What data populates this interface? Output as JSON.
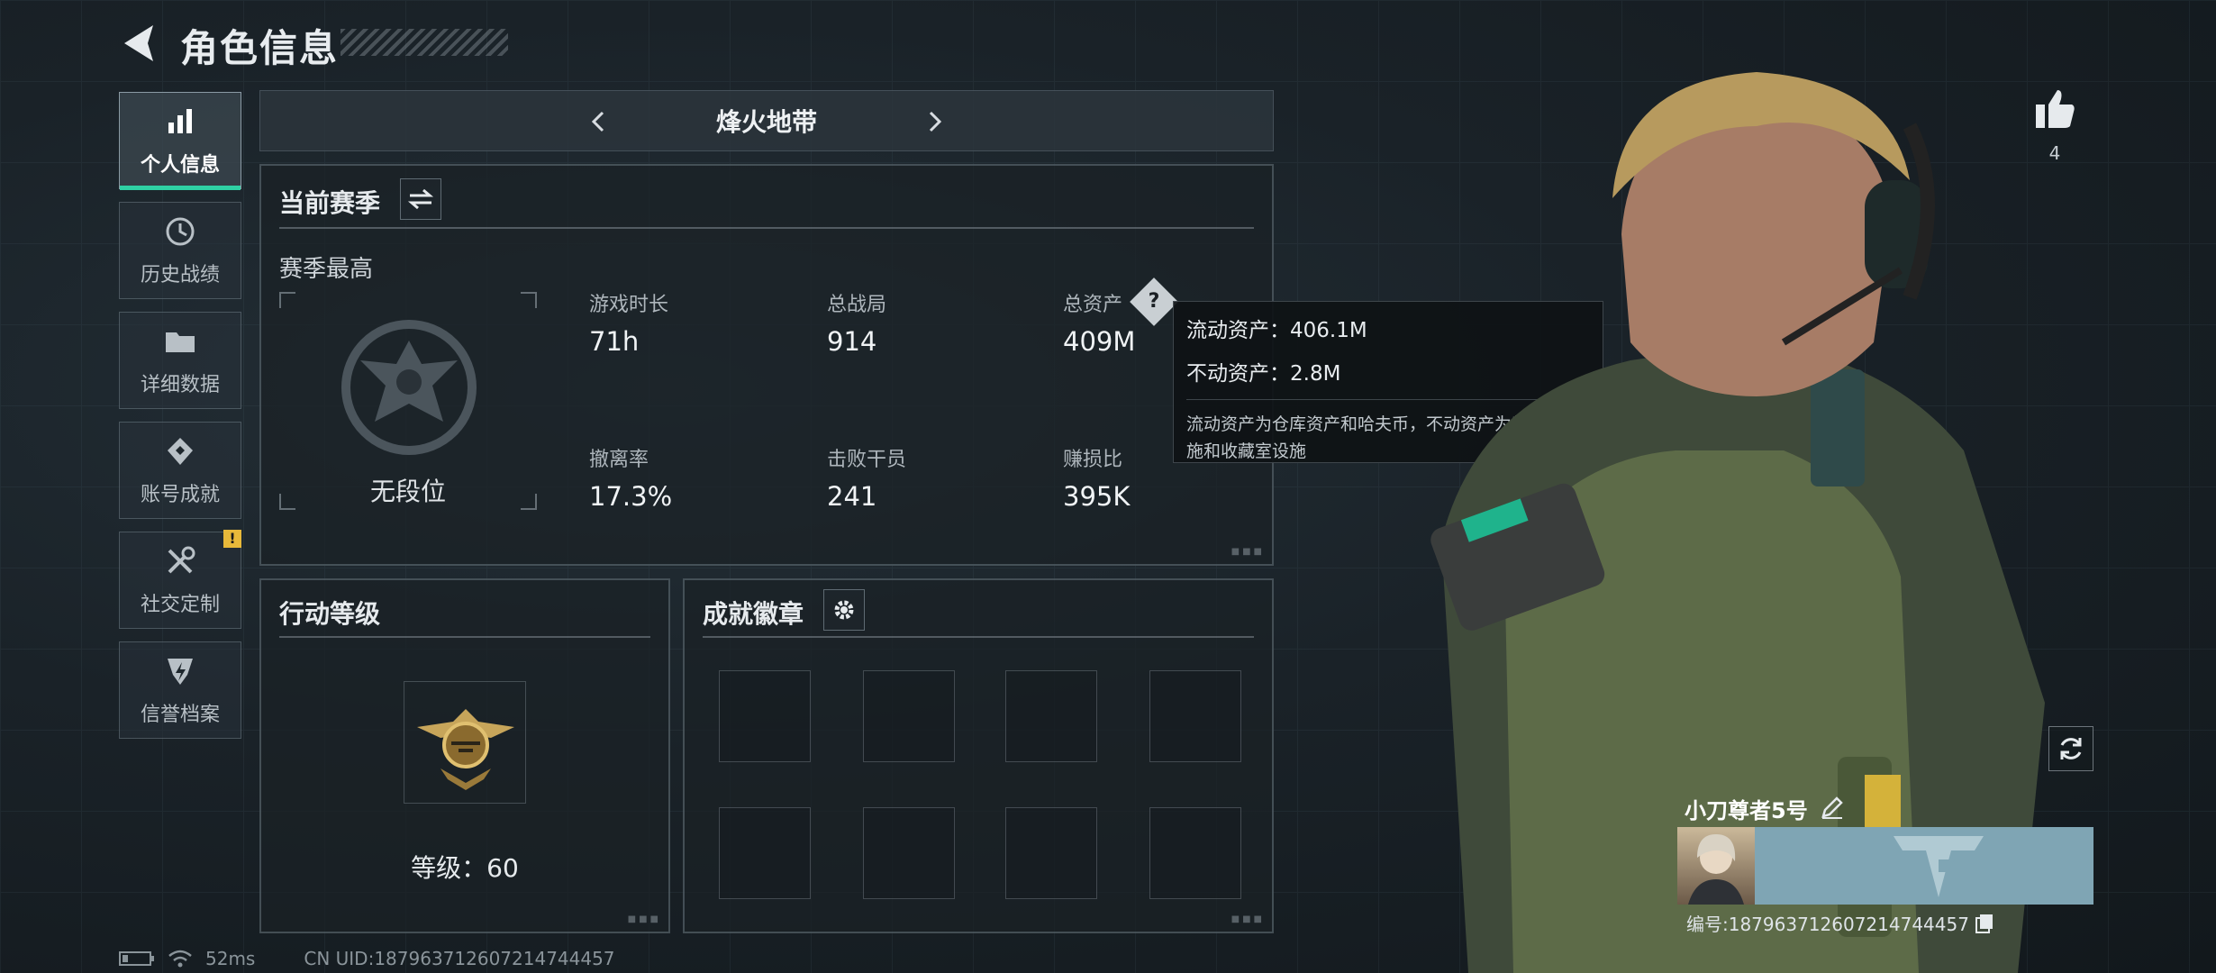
{
  "header": {
    "title": "角色信息"
  },
  "sidebar": {
    "items": [
      {
        "label": "个人信息",
        "icon": "bar-chart-icon"
      },
      {
        "label": "历史战绩",
        "icon": "history-icon"
      },
      {
        "label": "详细数据",
        "icon": "folder-icon"
      },
      {
        "label": "账号成就",
        "icon": "achievement-icon"
      },
      {
        "label": "社交定制",
        "icon": "tools-icon",
        "badge": "!"
      },
      {
        "label": "信誉档案",
        "icon": "shield-icon"
      }
    ]
  },
  "mode_selector": {
    "current": "烽火地带"
  },
  "season": {
    "title": "当前赛季",
    "best_label": "赛季最高",
    "rank_label": "无段位",
    "stats": [
      {
        "label": "游戏时长",
        "value": "71h"
      },
      {
        "label": "总战局",
        "value": "914"
      },
      {
        "label": "总资产",
        "value": "409M"
      },
      {
        "label": "撤离率",
        "value": "17.3%"
      },
      {
        "label": "击败干员",
        "value": "241"
      },
      {
        "label": "赚损比",
        "value": "395K"
      }
    ],
    "help_icon": "?"
  },
  "tooltip": {
    "liquid": "流动资产：406.1M",
    "fixed": "不动资产：2.8M",
    "note": "流动资产为仓库资产和哈夫币，不动资产为特勤处设施和收藏室设施"
  },
  "action_level": {
    "title": "行动等级",
    "level_text": "等级：60"
  },
  "achievements": {
    "title": "成就徽章",
    "slot_count": 8
  },
  "footer": {
    "ping": "52ms",
    "uid": "CN UID:187963712607214744457"
  },
  "profile": {
    "name": "小刀尊者5号",
    "id_line": "编号:187963712607214744457",
    "likes": "4"
  },
  "colors": {
    "accent": "#2fd1a4",
    "warning": "#e8b93a"
  }
}
